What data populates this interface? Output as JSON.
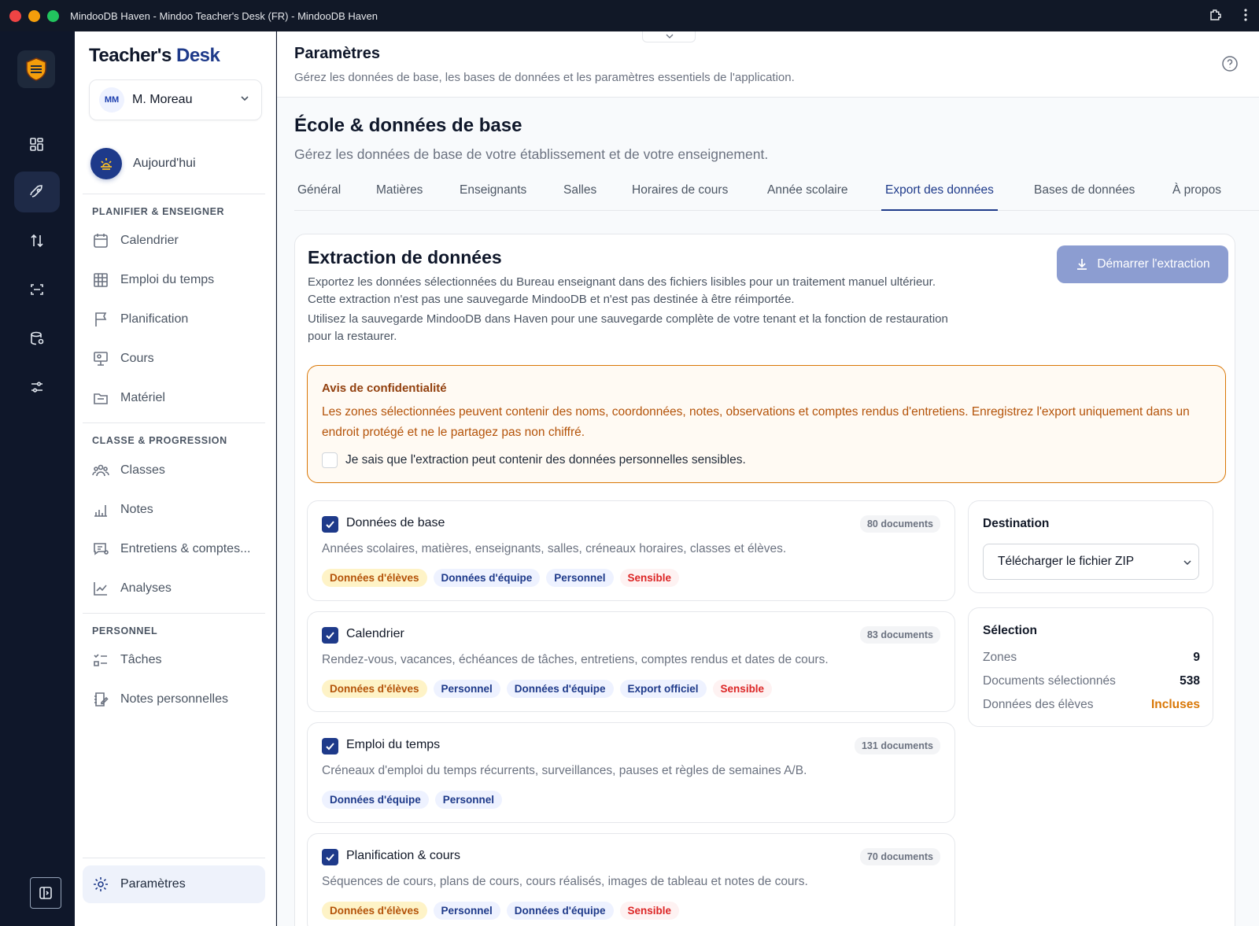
{
  "window": {
    "title": "MindooDB Haven - Mindoo Teacher's Desk (FR) - MindooDB Haven"
  },
  "brand": {
    "part1": "Teacher's",
    "part2": "Desk"
  },
  "user": {
    "initials": "MM",
    "name": "M. Moreau"
  },
  "today": {
    "label": "Aujourd'hui"
  },
  "sidebar": {
    "sections": {
      "plan": "PLANIFIER & ENSEIGNER",
      "class": "CLASSE & PROGRESSION",
      "personal": "PERSONNEL"
    },
    "plan_items": [
      "Calendrier",
      "Emploi du temps",
      "Planification",
      "Cours",
      "Matériel"
    ],
    "class_items": [
      "Classes",
      "Notes",
      "Entretiens & comptes...",
      "Analyses"
    ],
    "personal_items": [
      "Tâches",
      "Notes personnelles"
    ],
    "settings": "Paramètres"
  },
  "page": {
    "title": "Paramètres",
    "subtitle": "Gérez les données de base, les bases de données et les paramètres essentiels de l'application."
  },
  "section": {
    "title": "École & données de base",
    "subtitle": "Gérez les données de base de votre établissement et de votre enseignement."
  },
  "tabs": [
    "Général",
    "Matières",
    "Enseignants",
    "Salles",
    "Horaires de cours",
    "Année scolaire",
    "Export des données",
    "Bases de données",
    "À propos"
  ],
  "active_tab": "Export des données",
  "extraction": {
    "title": "Extraction de données",
    "desc1": "Exportez les données sélectionnées du Bureau enseignant dans des fichiers lisibles pour un traitement manuel ultérieur. Cette extraction n'est pas une sauvegarde MindooDB et n'est pas destinée à être réimportée.",
    "desc2": "Utilisez la sauvegarde MindooDB dans Haven pour une sauvegarde complète de votre tenant et la fonction de restauration pour la restaurer.",
    "start_button": "Démarrer l'extraction"
  },
  "privacy": {
    "title": "Avis de confidentialité",
    "text": "Les zones sélectionnées peuvent contenir des noms, coordonnées, notes, observations et comptes rendus d'entretiens. Enregistrez l'export uniquement dans un endroit protégé et ne le partagez pas non chiffré.",
    "checkbox_label": "Je sais que l'extraction peut contenir des données personnelles sensibles.",
    "checked": false
  },
  "zones": [
    {
      "title": "Données de base",
      "count": "80 documents",
      "desc": "Années scolaires, matières, enseignants, salles, créneaux horaires, classes et élèves.",
      "checked": true,
      "tags": [
        {
          "label": "Données d'élèves",
          "kind": "amber"
        },
        {
          "label": "Données d'équipe",
          "kind": "blue"
        },
        {
          "label": "Personnel",
          "kind": "blue"
        },
        {
          "label": "Sensible",
          "kind": "red"
        }
      ]
    },
    {
      "title": "Calendrier",
      "count": "83 documents",
      "desc": "Rendez-vous, vacances, échéances de tâches, entretiens, comptes rendus et dates de cours.",
      "checked": true,
      "tags": [
        {
          "label": "Données d'élèves",
          "kind": "amber"
        },
        {
          "label": "Personnel",
          "kind": "blue"
        },
        {
          "label": "Données d'équipe",
          "kind": "blue"
        },
        {
          "label": "Export officiel",
          "kind": "blue"
        },
        {
          "label": "Sensible",
          "kind": "red"
        }
      ]
    },
    {
      "title": "Emploi du temps",
      "count": "131 documents",
      "desc": "Créneaux d'emploi du temps récurrents, surveillances, pauses et règles de semaines A/B.",
      "checked": true,
      "tags": [
        {
          "label": "Données d'équipe",
          "kind": "blue"
        },
        {
          "label": "Personnel",
          "kind": "blue"
        }
      ]
    },
    {
      "title": "Planification & cours",
      "count": "70 documents",
      "desc": "Séquences de cours, plans de cours, cours réalisés, images de tableau et notes de cours.",
      "checked": true,
      "tags": [
        {
          "label": "Données d'élèves",
          "kind": "amber"
        },
        {
          "label": "Personnel",
          "kind": "blue"
        },
        {
          "label": "Données d'équipe",
          "kind": "blue"
        },
        {
          "label": "Sensible",
          "kind": "red"
        }
      ]
    }
  ],
  "destination": {
    "title": "Destination",
    "selected": "Télécharger le fichier ZIP"
  },
  "selection": {
    "title": "Sélection",
    "zones_label": "Zones",
    "zones_value": "9",
    "docs_label": "Documents sélectionnés",
    "docs_value": "538",
    "students_label": "Données des élèves",
    "students_value": "Incluses"
  },
  "colors": {
    "accent": "#1e3a8a",
    "warning": "#d97706",
    "danger": "#dc2626"
  }
}
